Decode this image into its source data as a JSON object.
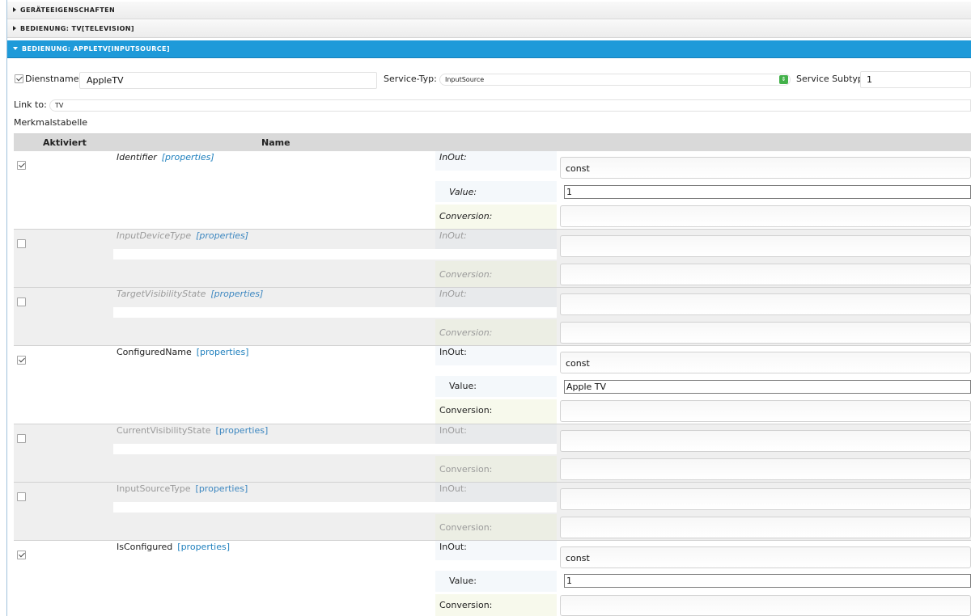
{
  "accordion": [
    {
      "label": "GERÄTEEIGENSCHAFTEN",
      "state": "collapsed"
    },
    {
      "label": "BEDIENUNG: TV[TELEVISION]",
      "state": "collapsed"
    },
    {
      "label": "BEDIENUNG: APPLETV[INPUTSOURCE]",
      "state": "expanded"
    }
  ],
  "form": {
    "dienstname_label": "Dienstname:",
    "dienstname_value": "AppleTV",
    "service_typ_label": "Service-Typ:",
    "service_typ_value": "InputSource",
    "service_subtyp_label": "Service Subtyp:",
    "service_subtyp_value": "1",
    "link_to_label": "Link to:",
    "link_to_value": "TV",
    "table_title": "Merkmalstabelle"
  },
  "table": {
    "headers": {
      "activated": "Aktiviert",
      "name": "Name"
    },
    "labels": {
      "inout": "InOut:",
      "value": "Value:",
      "conversion": "Conversion:",
      "properties": "[properties]"
    },
    "rows": [
      {
        "name": "Identifier",
        "checked": true,
        "inout": "const",
        "value": "1"
      },
      {
        "name": "InputDeviceType",
        "checked": false,
        "inout": "",
        "value": null
      },
      {
        "name": "TargetVisibilityState",
        "checked": false,
        "inout": "",
        "value": null
      },
      {
        "name": "ConfiguredName",
        "checked": true,
        "inout": "const",
        "value": "Apple TV"
      },
      {
        "name": "CurrentVisibilityState",
        "checked": false,
        "inout": "",
        "value": null
      },
      {
        "name": "InputSourceType",
        "checked": false,
        "inout": "",
        "value": null
      },
      {
        "name": "IsConfigured",
        "checked": true,
        "inout": "const",
        "value": "1"
      }
    ]
  },
  "colors": {
    "accent": "#1e9ad9",
    "enabled_checkbox": "#444444",
    "link": "#1e7fbd"
  }
}
